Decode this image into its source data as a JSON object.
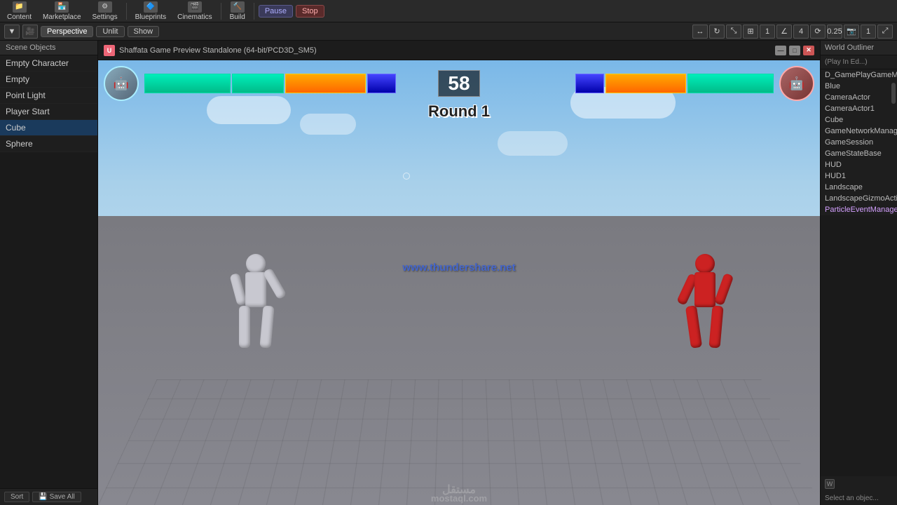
{
  "toolbar": {
    "content_label": "Content",
    "marketplace_label": "Marketplace",
    "settings_label": "Settings",
    "blueprints_label": "Blueprints",
    "cinematics_label": "Cinematics",
    "build_label": "Build",
    "pause_label": "Pause",
    "stop_label": "Stop",
    "play_icon": "▶",
    "pause_icon": "⏸",
    "stop_icon": "⏹"
  },
  "viewport_toolbar": {
    "perspective_label": "Perspective",
    "unlit_label": "Unlit",
    "show_label": "Show",
    "grid_snap": "0.25",
    "rotation_snap": "4",
    "scale_snap": "1"
  },
  "left_panel": {
    "items": [
      {
        "label": "Empty Character"
      },
      {
        "label": "Empty"
      },
      {
        "label": "Point Light"
      },
      {
        "label": "Player Start"
      },
      {
        "label": "Cube"
      },
      {
        "label": "Sphere"
      }
    ]
  },
  "game_window": {
    "title": "Shaffata Game Preview Standalone (64-bit/PCD3D_SM5)",
    "timer": "58",
    "round_label": "Round 1",
    "watermark": "www.thundershare.net",
    "watermark2": "مستقل",
    "watermark3": "mostaql.com"
  },
  "hud": {
    "p1_health_pct": 75,
    "p2_health_pct": 60,
    "timer": "58",
    "round": "Round 1"
  },
  "right_panel": {
    "title": "World Outliner",
    "play_mode": "(Play In Ed...)",
    "select_info": "Select an objec...",
    "items": [
      {
        "label": "D_GamePlayGameMo...",
        "style": "normal"
      },
      {
        "label": "Blue",
        "style": "normal"
      },
      {
        "label": "CameraActor",
        "style": "normal"
      },
      {
        "label": "CameraActor1",
        "style": "normal"
      },
      {
        "label": "Cube",
        "style": "normal"
      },
      {
        "label": "GameNetworkManag...",
        "style": "normal"
      },
      {
        "label": "GameSession",
        "style": "normal"
      },
      {
        "label": "GameStateBase",
        "style": "normal"
      },
      {
        "label": "HUD",
        "style": "normal"
      },
      {
        "label": "HUD1",
        "style": "normal"
      },
      {
        "label": "Landscape",
        "style": "normal"
      },
      {
        "label": "LandscapeGizmoActi...",
        "style": "normal"
      },
      {
        "label": "ParticleEventManage...",
        "style": "highlight"
      }
    ]
  },
  "bottom_bar": {
    "sort_label": "Sort",
    "save_all_label": "Save All"
  }
}
